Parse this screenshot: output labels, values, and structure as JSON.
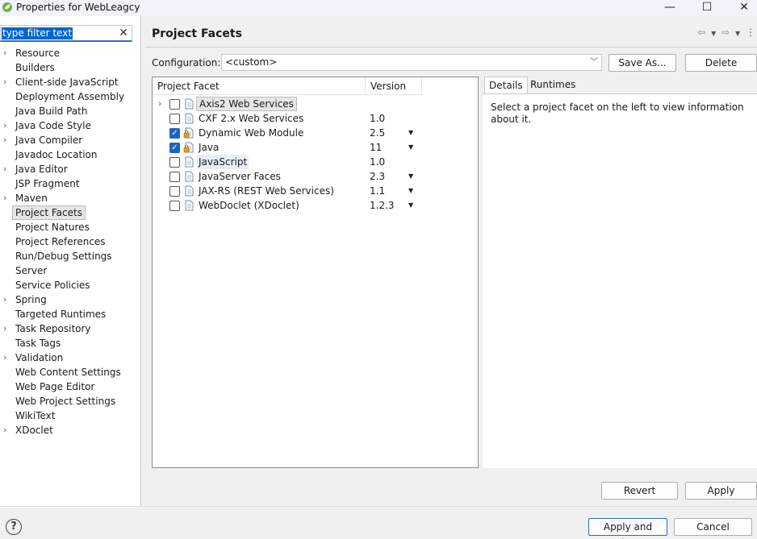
{
  "window": {
    "title": "Properties for WebLeagcy",
    "minimize_glyph": "—",
    "maximize_glyph": "☐",
    "close_glyph": "✕"
  },
  "sidebar": {
    "filter_text": "type filter text",
    "clear_glyph": "✕",
    "items": [
      {
        "label": "Resource",
        "expandable": true
      },
      {
        "label": "Builders",
        "expandable": false
      },
      {
        "label": "Client-side JavaScript",
        "expandable": true
      },
      {
        "label": "Deployment Assembly",
        "expandable": false
      },
      {
        "label": "Java Build Path",
        "expandable": false
      },
      {
        "label": "Java Code Style",
        "expandable": true
      },
      {
        "label": "Java Compiler",
        "expandable": true
      },
      {
        "label": "Javadoc Location",
        "expandable": false
      },
      {
        "label": "Java Editor",
        "expandable": true
      },
      {
        "label": "JSP Fragment",
        "expandable": false
      },
      {
        "label": "Maven",
        "expandable": true
      },
      {
        "label": "Project Facets",
        "expandable": false,
        "selected": true
      },
      {
        "label": "Project Natures",
        "expandable": false
      },
      {
        "label": "Project References",
        "expandable": false
      },
      {
        "label": "Run/Debug Settings",
        "expandable": false
      },
      {
        "label": "Server",
        "expandable": false
      },
      {
        "label": "Service Policies",
        "expandable": false
      },
      {
        "label": "Spring",
        "expandable": true
      },
      {
        "label": "Targeted Runtimes",
        "expandable": false
      },
      {
        "label": "Task Repository",
        "expandable": true
      },
      {
        "label": "Task Tags",
        "expandable": false
      },
      {
        "label": "Validation",
        "expandable": true
      },
      {
        "label": "Web Content Settings",
        "expandable": false
      },
      {
        "label": "Web Page Editor",
        "expandable": false
      },
      {
        "label": "Web Project Settings",
        "expandable": false
      },
      {
        "label": "WikiText",
        "expandable": false
      },
      {
        "label": "XDoclet",
        "expandable": true
      }
    ]
  },
  "main": {
    "title": "Project Facets",
    "configuration_label": "Configuration:",
    "configuration_value": "<custom>",
    "save_as_label": "Save As...",
    "delete_label": "Delete",
    "table": {
      "col_facet": "Project Facet",
      "col_version": "Version",
      "rows": [
        {
          "name": "Axis2 Web Services",
          "version": "",
          "checked": false,
          "expandable": true,
          "dropdown": false,
          "selected": true,
          "icon": "page-icon"
        },
        {
          "name": "CXF 2.x Web Services",
          "version": "1.0",
          "checked": false,
          "expandable": false,
          "dropdown": false,
          "icon": "page-icon"
        },
        {
          "name": "Dynamic Web Module",
          "version": "2.5",
          "checked": true,
          "expandable": false,
          "dropdown": true,
          "icon": "web-module-lock-icon"
        },
        {
          "name": "Java",
          "version": "11",
          "checked": true,
          "expandable": false,
          "dropdown": true,
          "icon": "lock-page-icon"
        },
        {
          "name": "JavaScript",
          "version": "1.0",
          "checked": false,
          "expandable": false,
          "dropdown": false,
          "highlight": true,
          "icon": "page-icon"
        },
        {
          "name": "JavaServer Faces",
          "version": "2.3",
          "checked": false,
          "expandable": false,
          "dropdown": true,
          "icon": "page-icon"
        },
        {
          "name": "JAX-RS (REST Web Services)",
          "version": "1.1",
          "checked": false,
          "expandable": false,
          "dropdown": true,
          "icon": "page-icon"
        },
        {
          "name": "WebDoclet (XDoclet)",
          "version": "1.2.3",
          "checked": false,
          "expandable": false,
          "dropdown": true,
          "icon": "page-icon"
        }
      ]
    },
    "tabs": {
      "details": "Details",
      "runtimes": "Runtimes"
    },
    "details_text": "Select a project facet on the left to view information about it.",
    "revert_label": "Revert",
    "apply_label": "Apply"
  },
  "footer": {
    "apply_close_label": "Apply and Close",
    "cancel_label": "Cancel",
    "help_glyph": "?"
  },
  "colors": {
    "accent": "#1e63c4",
    "selection": "#0066cc"
  }
}
